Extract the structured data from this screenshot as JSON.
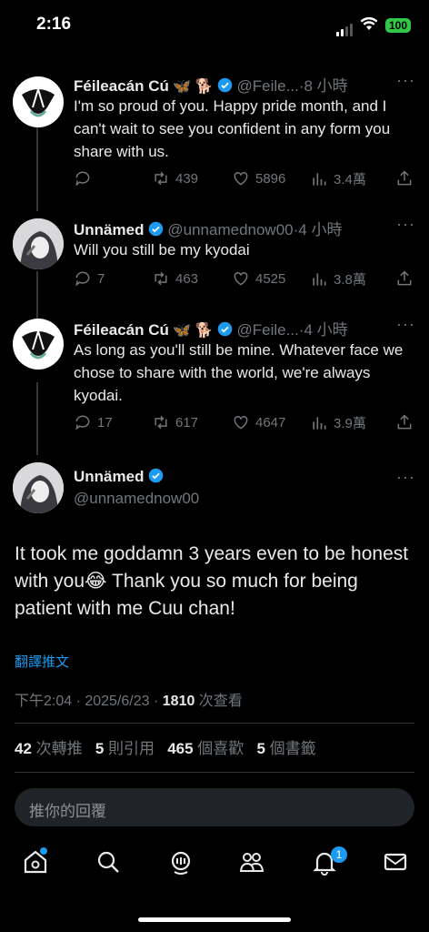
{
  "status_bar": {
    "time": "2:16",
    "battery": "100"
  },
  "tweets": [
    {
      "name": "Féileacán Cú",
      "emojis": "🦋 🐕",
      "handle": "@Feile...",
      "time": "·8 小時",
      "text": "I'm so proud of you. Happy pride month, and I can't wait to see you confident in any form you share with us.",
      "replies": "",
      "retweets": "439",
      "likes": "5896",
      "views": "3.4萬"
    },
    {
      "name": "Unnämed",
      "handle": "@unnamednow00",
      "time": "·4 小時",
      "text": "Will you still be my kyodai",
      "replies": "7",
      "retweets": "463",
      "likes": "4525",
      "views": "3.8萬"
    },
    {
      "name": "Féileacán Cú",
      "emojis": "🦋 🐕",
      "handle": "@Feile...",
      "time": "·4 小時",
      "text": "As long as you'll still be mine. Whatever face we chose to share with the world, we're always kyodai.",
      "replies": "17",
      "retweets": "617",
      "likes": "4647",
      "views": "3.9萬"
    }
  ],
  "main_tweet": {
    "name": "Unnämed",
    "handle": "@unnamednow00",
    "text": "It took me goddamn 3 years even to be honest with you😂 Thank you so much for being patient with me Cuu chan!",
    "translate": "翻譯推文",
    "timestamp": "下午2:04 · 2025/6/23 · ",
    "views_count": "1810",
    "views_label": " 次查看",
    "stats": {
      "retweets_count": "42",
      "retweets_label": " 次轉推",
      "quotes_count": "5",
      "quotes_label": " 則引用",
      "likes_count": "465",
      "likes_label": " 個喜歡",
      "bookmarks_count": "5",
      "bookmarks_label": " 個書籤"
    }
  },
  "reply_placeholder": "推你的回覆",
  "tabbar": {
    "notification_badge": "1"
  },
  "colors": {
    "accent": "#1d9bf0",
    "background": "#000000",
    "muted": "#71767b"
  }
}
